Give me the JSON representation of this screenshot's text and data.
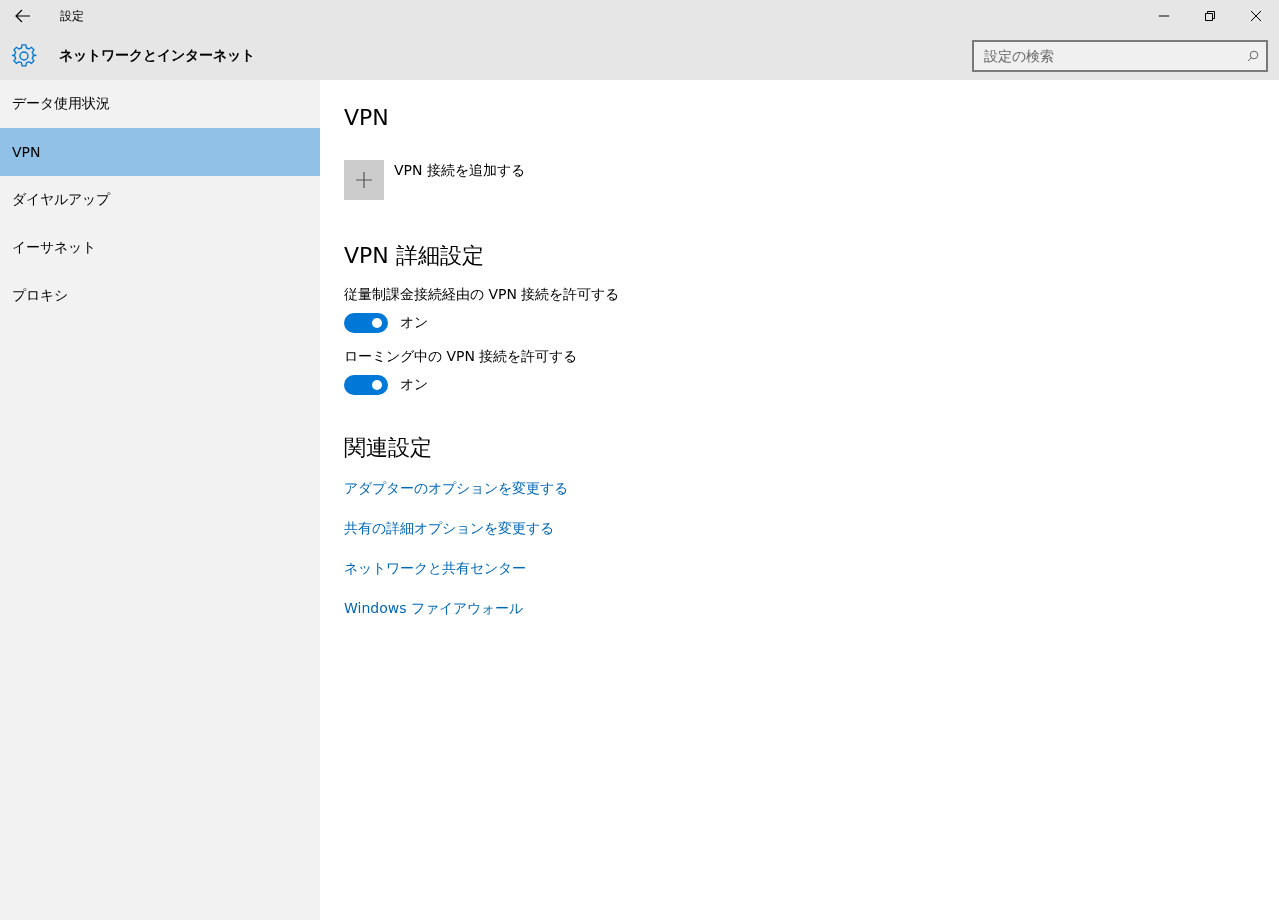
{
  "window": {
    "title": "設定"
  },
  "header": {
    "title": "ネットワークとインターネット",
    "search": {
      "placeholder": "設定の検索"
    }
  },
  "sidebar": {
    "items": [
      {
        "label": "データ使用状況",
        "selected": false
      },
      {
        "label": "VPN",
        "selected": true
      },
      {
        "label": "ダイヤルアップ",
        "selected": false
      },
      {
        "label": "イーサネット",
        "selected": false
      },
      {
        "label": "プロキシ",
        "selected": false
      }
    ]
  },
  "content": {
    "vpn_heading": "VPN",
    "add_label": "VPN 接続を追加する",
    "advanced_heading": "VPN 詳細設定",
    "toggles": [
      {
        "label": "従量制課金接続経由の VPN 接続を許可する",
        "on": true,
        "state_text": "オン"
      },
      {
        "label": "ローミング中の VPN 接続を許可する",
        "on": true,
        "state_text": "オン"
      }
    ],
    "related_heading": "関連設定",
    "links": [
      "アダプターのオプションを変更する",
      "共有の詳細オプションを変更する",
      "ネットワークと共有センター",
      "Windows ファイアウォール"
    ]
  }
}
